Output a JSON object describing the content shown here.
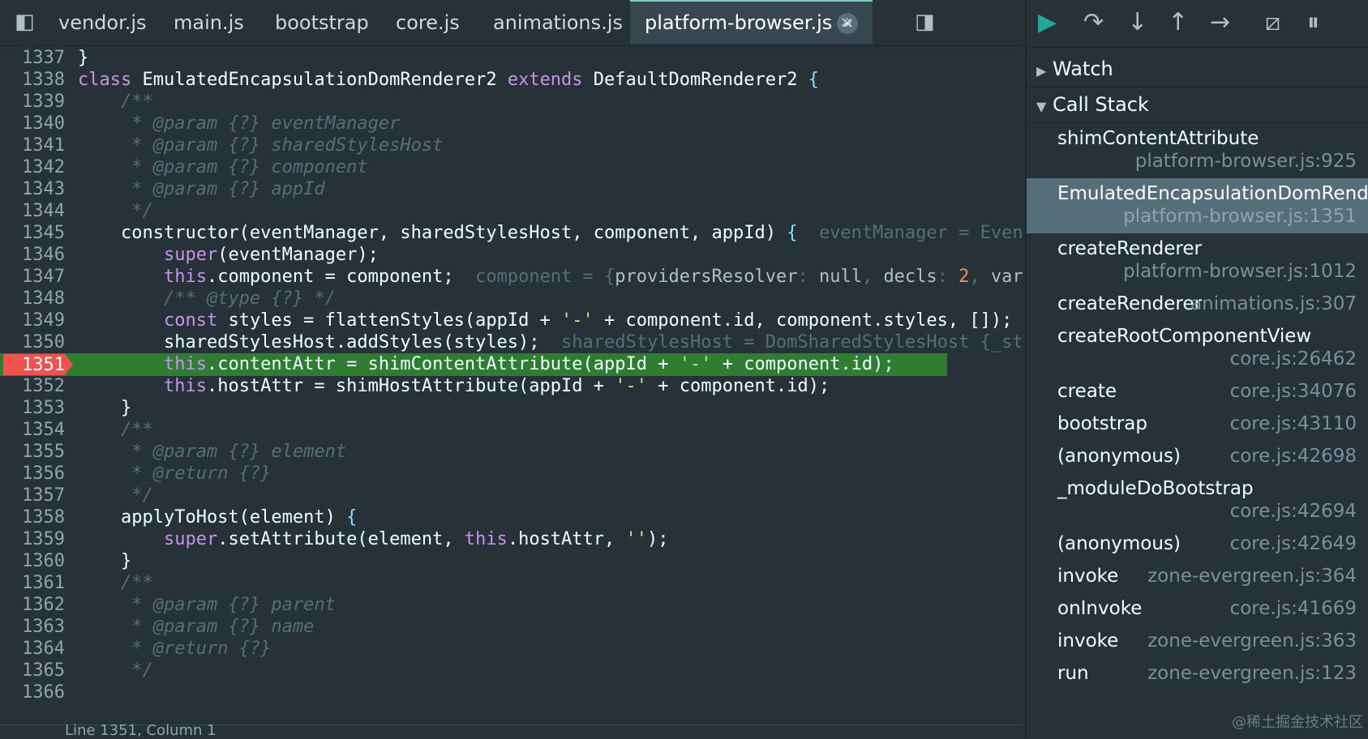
{
  "tabs": [
    "vendor.js",
    "main.js",
    "bootstrap",
    "core.js",
    "animations.js",
    "platform-browser.js"
  ],
  "active_tab": "platform-browser.js",
  "more_tabs_glyph": "»",
  "code_lines": [
    {
      "n": "1337",
      "html": "}"
    },
    {
      "n": "1338",
      "html": "<span class='kw'>class</span> EmulatedEncapsulationDomRenderer2 <span class='kw'>extends</span> DefaultDomRenderer2 <span class='punc'>{</span>"
    },
    {
      "n": "1339",
      "html": "    <span class='cm'>/**</span>"
    },
    {
      "n": "1340",
      "html": "     <span class='cm'>* @param {?} eventManager</span>"
    },
    {
      "n": "1341",
      "html": "     <span class='cm'>* @param {?} sharedStylesHost</span>"
    },
    {
      "n": "1342",
      "html": "     <span class='cm'>* @param {?} component</span>"
    },
    {
      "n": "1343",
      "html": "     <span class='cm'>* @param {?} appId</span>"
    },
    {
      "n": "1344",
      "html": "     <span class='cm'>*/</span>"
    },
    {
      "n": "1345",
      "html": "    constructor(eventManager, sharedStylesHost, component, appId) <span class='punc'>{</span>  <span class='inl'>eventManager = Even</span>"
    },
    {
      "n": "1346",
      "html": "        <span class='kw'>super</span>(eventManager);"
    },
    {
      "n": "1347",
      "html": "        <span class='kw'>this</span>.component = component;  <span class='inl'>component = {<span class='inlv'>providersResolver</span>: <span class='inlv'>null</span>, <span class='inlv'>decls</span>: <span class='num'>2</span>, <span class='inlv'>var</span></span>"
    },
    {
      "n": "1348",
      "html": "        <span class='cm'>/** @type {?} */</span>"
    },
    {
      "n": "1349",
      "html": "        <span class='kw'>const</span> styles = flattenStyles(appId + <span class='str'>'-'</span> + component.id, component.styles, []);"
    },
    {
      "n": "1350",
      "html": "        sharedStylesHost.addStyles(styles);  <span class='inl'>sharedStylesHost = DomSharedStylesHost {_st</span>"
    },
    {
      "n": "1351",
      "html": "        <span class='kw'>this</span>.contentAttr = shimContentAttribute(appId + <span class='str'>'-'</span> + component.id);",
      "highlight": true,
      "breakpoint": true
    },
    {
      "n": "1352",
      "html": "        <span class='kw'>this</span>.hostAttr = shimHostAttribute(appId + <span class='str'>'-'</span> + component.id);"
    },
    {
      "n": "1353",
      "html": "    }"
    },
    {
      "n": "1354",
      "html": "    <span class='cm'>/**</span>"
    },
    {
      "n": "1355",
      "html": "     <span class='cm'>* @param {?} element</span>"
    },
    {
      "n": "1356",
      "html": "     <span class='cm'>* @return {?}</span>"
    },
    {
      "n": "1357",
      "html": "     <span class='cm'>*/</span>"
    },
    {
      "n": "1358",
      "html": "    applyToHost(element) <span class='punc'>{</span>"
    },
    {
      "n": "1359",
      "html": "        <span class='kw'>super</span>.setAttribute(element, <span class='kw'>this</span>.hostAttr, <span class='str'>''</span>);"
    },
    {
      "n": "1360",
      "html": "    }"
    },
    {
      "n": "1361",
      "html": "    <span class='cm'>/**</span>"
    },
    {
      "n": "1362",
      "html": "     <span class='cm'>* @param {?} parent</span>"
    },
    {
      "n": "1363",
      "html": "     <span class='cm'>* @param {?} name</span>"
    },
    {
      "n": "1364",
      "html": "     <span class='cm'>* @return {?}</span>"
    },
    {
      "n": "1365",
      "html": "     <span class='cm'>*/</span>"
    },
    {
      "n": "1366",
      "html": ""
    }
  ],
  "status": {
    "text": "Line 1351, Column 1"
  },
  "debug": {
    "watch_label": "Watch",
    "callstack_label": "Call Stack",
    "frames": [
      {
        "name": "shimContentAttribute",
        "loc": "platform-browser.js:925",
        "two_line": true
      },
      {
        "name": "EmulatedEncapsulationDomRende…",
        "loc": "platform-browser.js:1351",
        "two_line": true,
        "selected": true
      },
      {
        "name": "createRenderer",
        "loc": "platform-browser.js:1012",
        "two_line": true
      },
      {
        "name": "createRenderer",
        "loc": "animations.js:307",
        "two_line": false
      },
      {
        "name": "createRootComponentView",
        "loc": "core.js:26462",
        "two_line": true
      },
      {
        "name": "create",
        "loc": "core.js:34076",
        "two_line": false
      },
      {
        "name": "bootstrap",
        "loc": "core.js:43110",
        "two_line": false
      },
      {
        "name": "(anonymous)",
        "loc": "core.js:42698",
        "two_line": false
      },
      {
        "name": "_moduleDoBootstrap",
        "loc": "core.js:42694",
        "two_line": true
      },
      {
        "name": "(anonymous)",
        "loc": "core.js:42649",
        "two_line": false
      },
      {
        "name": "invoke",
        "loc": "zone-evergreen.js:364",
        "two_line": false
      },
      {
        "name": "onInvoke",
        "loc": "core.js:41669",
        "two_line": false
      },
      {
        "name": "invoke",
        "loc": "zone-evergreen.js:363",
        "two_line": false
      },
      {
        "name": "run",
        "loc": "zone-evergreen.js:123",
        "two_line": false
      }
    ]
  },
  "watermark": "@稀土掘金技术社区",
  "icons": {
    "sidebar_toggle": "◧",
    "right_toggle": "◨",
    "resume": "▶",
    "step_over": "↷",
    "step_into": "↓",
    "step_out": "↑",
    "step": "→",
    "deactivate": "⧄",
    "pause": "⏸"
  }
}
